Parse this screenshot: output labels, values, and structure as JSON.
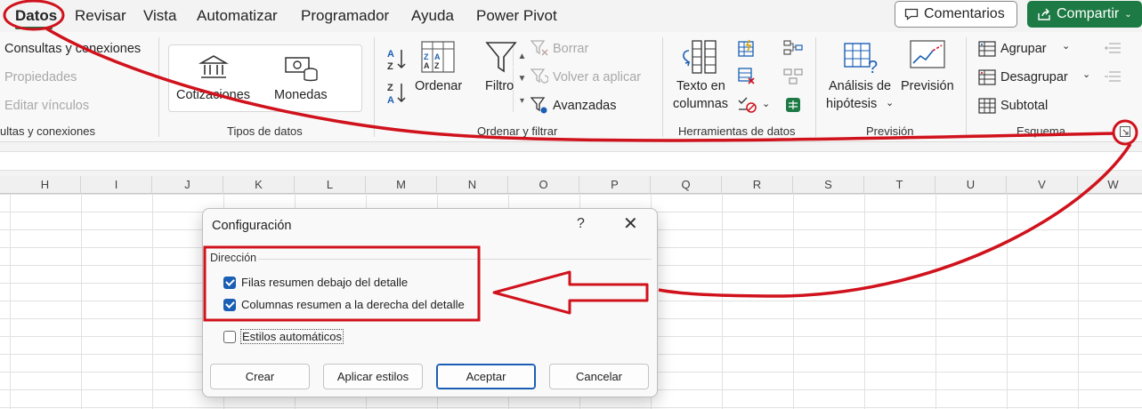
{
  "tabs": [
    "Datos",
    "Revisar",
    "Vista",
    "Automatizar",
    "Programador",
    "Ayuda",
    "Power Pivot"
  ],
  "header": {
    "comments_label": "Comentarios",
    "share_label": "Compartir"
  },
  "ribbon": {
    "consultas": {
      "items": [
        "Consultas y conexiones",
        "Propiedades",
        "Editar vínculos"
      ],
      "group_label": "ultas y conexiones"
    },
    "tipos": {
      "cotizaciones": "Cotizaciones",
      "monedas": "Monedas",
      "group_label": "Tipos de datos"
    },
    "ordenar": {
      "ordenar": "Ordenar",
      "filtro": "Filtro",
      "borrar": "Borrar",
      "volver": "Volver a aplicar",
      "avanzadas": "Avanzadas",
      "group_label": "Ordenar y filtrar"
    },
    "herramientas": {
      "texto_line1": "Texto en",
      "texto_line2": "columnas",
      "group_label": "Herramientas de datos"
    },
    "prevision": {
      "analisis_line1": "Análisis de",
      "analisis_line2": "hipótesis",
      "prevision_btn": "Previsión",
      "group_label": "Previsión"
    },
    "esquema": {
      "agrupar": "Agrupar",
      "desagrupar": "Desagrupar",
      "subtotal": "Subtotal",
      "group_label": "Esquema"
    }
  },
  "columns": [
    "H",
    "I",
    "J",
    "K",
    "L",
    "M",
    "N",
    "O",
    "P",
    "Q",
    "R",
    "S",
    "T",
    "U",
    "V",
    "W"
  ],
  "dialog": {
    "title": "Configuración",
    "help": "?",
    "close": "✕",
    "section": "Dirección",
    "checkboxes": [
      {
        "label": "Filas resumen debajo del detalle",
        "checked": true
      },
      {
        "label": "Columnas resumen a la derecha del detalle",
        "checked": true
      },
      {
        "label": "Estilos automáticos",
        "checked": false
      }
    ],
    "buttons": [
      "Crear",
      "Aplicar estilos",
      "Aceptar",
      "Cancelar"
    ]
  },
  "colors": {
    "accent_green": "#217346",
    "share_green": "#1e7a45",
    "annotation_red": "#d0121c",
    "checkbox_blue": "#1a5fb4"
  }
}
